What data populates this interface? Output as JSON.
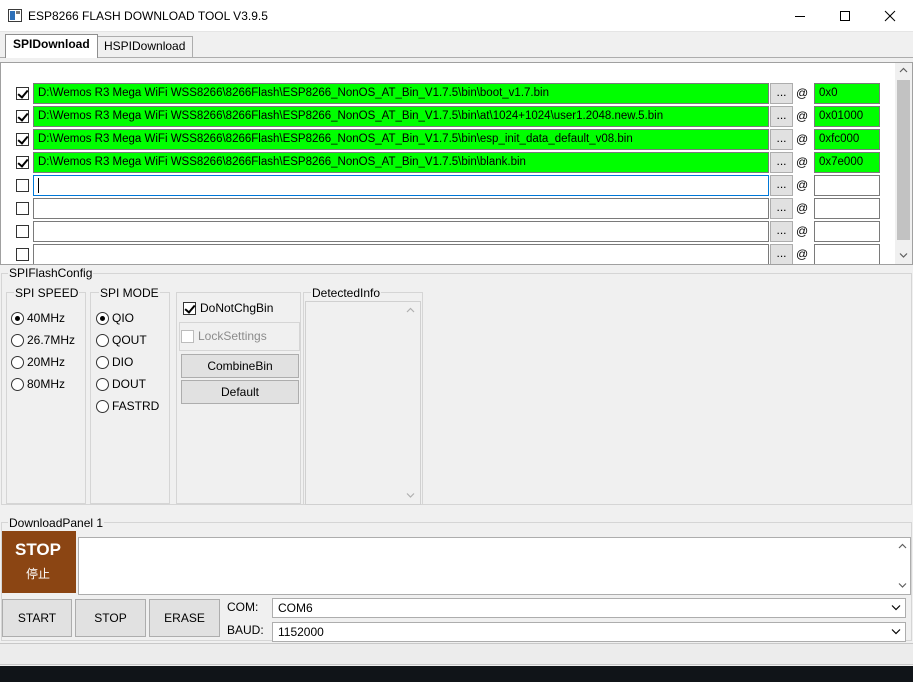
{
  "window": {
    "title": "ESP8266 FLASH DOWNLOAD TOOL V3.9.5",
    "icon": "app-window-icon",
    "controls": [
      "minimize-icon",
      "maximize-icon",
      "close-icon"
    ]
  },
  "tabs": [
    {
      "label": "SPIDownload",
      "active": true
    },
    {
      "label": "HSPIDownload",
      "active": false
    }
  ],
  "files": [
    {
      "checked": true,
      "path": "D:\\Wemos R3 Mega WiFi WSS8266\\8266Flash\\ESP8266_NonOS_AT_Bin_V1.7.5\\bin\\boot_v1.7.bin",
      "browse": "...",
      "at": "@",
      "addr": "0x0",
      "highlight": true
    },
    {
      "checked": true,
      "path": "D:\\Wemos R3 Mega WiFi WSS8266\\8266Flash\\ESP8266_NonOS_AT_Bin_V1.7.5\\bin\\at\\1024+1024\\user1.2048.new.5.bin",
      "browse": "...",
      "at": "@",
      "addr": "0x01000",
      "highlight": true
    },
    {
      "checked": true,
      "path": "D:\\Wemos R3 Mega WiFi WSS8266\\8266Flash\\ESP8266_NonOS_AT_Bin_V1.7.5\\bin\\esp_init_data_default_v08.bin",
      "browse": "...",
      "at": "@",
      "addr": "0xfc000",
      "highlight": true
    },
    {
      "checked": true,
      "path": "D:\\Wemos R3 Mega WiFi WSS8266\\8266Flash\\ESP8266_NonOS_AT_Bin_V1.7.5\\bin\\blank.bin",
      "browse": "...",
      "at": "@",
      "addr": "0x7e000",
      "highlight": true
    },
    {
      "checked": false,
      "path": "",
      "browse": "...",
      "at": "@",
      "addr": "",
      "highlight": false
    },
    {
      "checked": false,
      "path": "",
      "browse": "...",
      "at": "@",
      "addr": "",
      "highlight": false
    },
    {
      "checked": false,
      "path": "",
      "browse": "...",
      "at": "@",
      "addr": "",
      "highlight": false
    },
    {
      "checked": false,
      "path": "",
      "browse": "...",
      "at": "@",
      "addr": "",
      "highlight": false
    }
  ],
  "spiflash": {
    "title": "SPIFlashConfig",
    "speed": {
      "title": "SPI SPEED",
      "options": [
        "40MHz",
        "26.7MHz",
        "20MHz",
        "80MHz"
      ],
      "selected": "40MHz"
    },
    "mode": {
      "title": "SPI MODE",
      "options": [
        "QIO",
        "QOUT",
        "DIO",
        "DOUT",
        "FASTRD"
      ],
      "selected": "QIO"
    },
    "donotchg_label": "DoNotChgBin",
    "donotchg_checked": true,
    "locksettings_label": "LockSettings",
    "locksettings_checked": false,
    "combine_label": "CombineBin",
    "default_label": "Default",
    "detected_title": "DetectedInfo"
  },
  "download_panel": {
    "title": "DownloadPanel 1",
    "state_label": "STOP",
    "state_label_cn": "停止",
    "state_color": "#8b4513",
    "start_label": "START",
    "stop_label": "STOP",
    "erase_label": "ERASE",
    "com_label": "COM:",
    "com_value": "COM6",
    "baud_label": "BAUD:",
    "baud_value": "1152000"
  },
  "colors": {
    "highlight": "#00ff00"
  }
}
